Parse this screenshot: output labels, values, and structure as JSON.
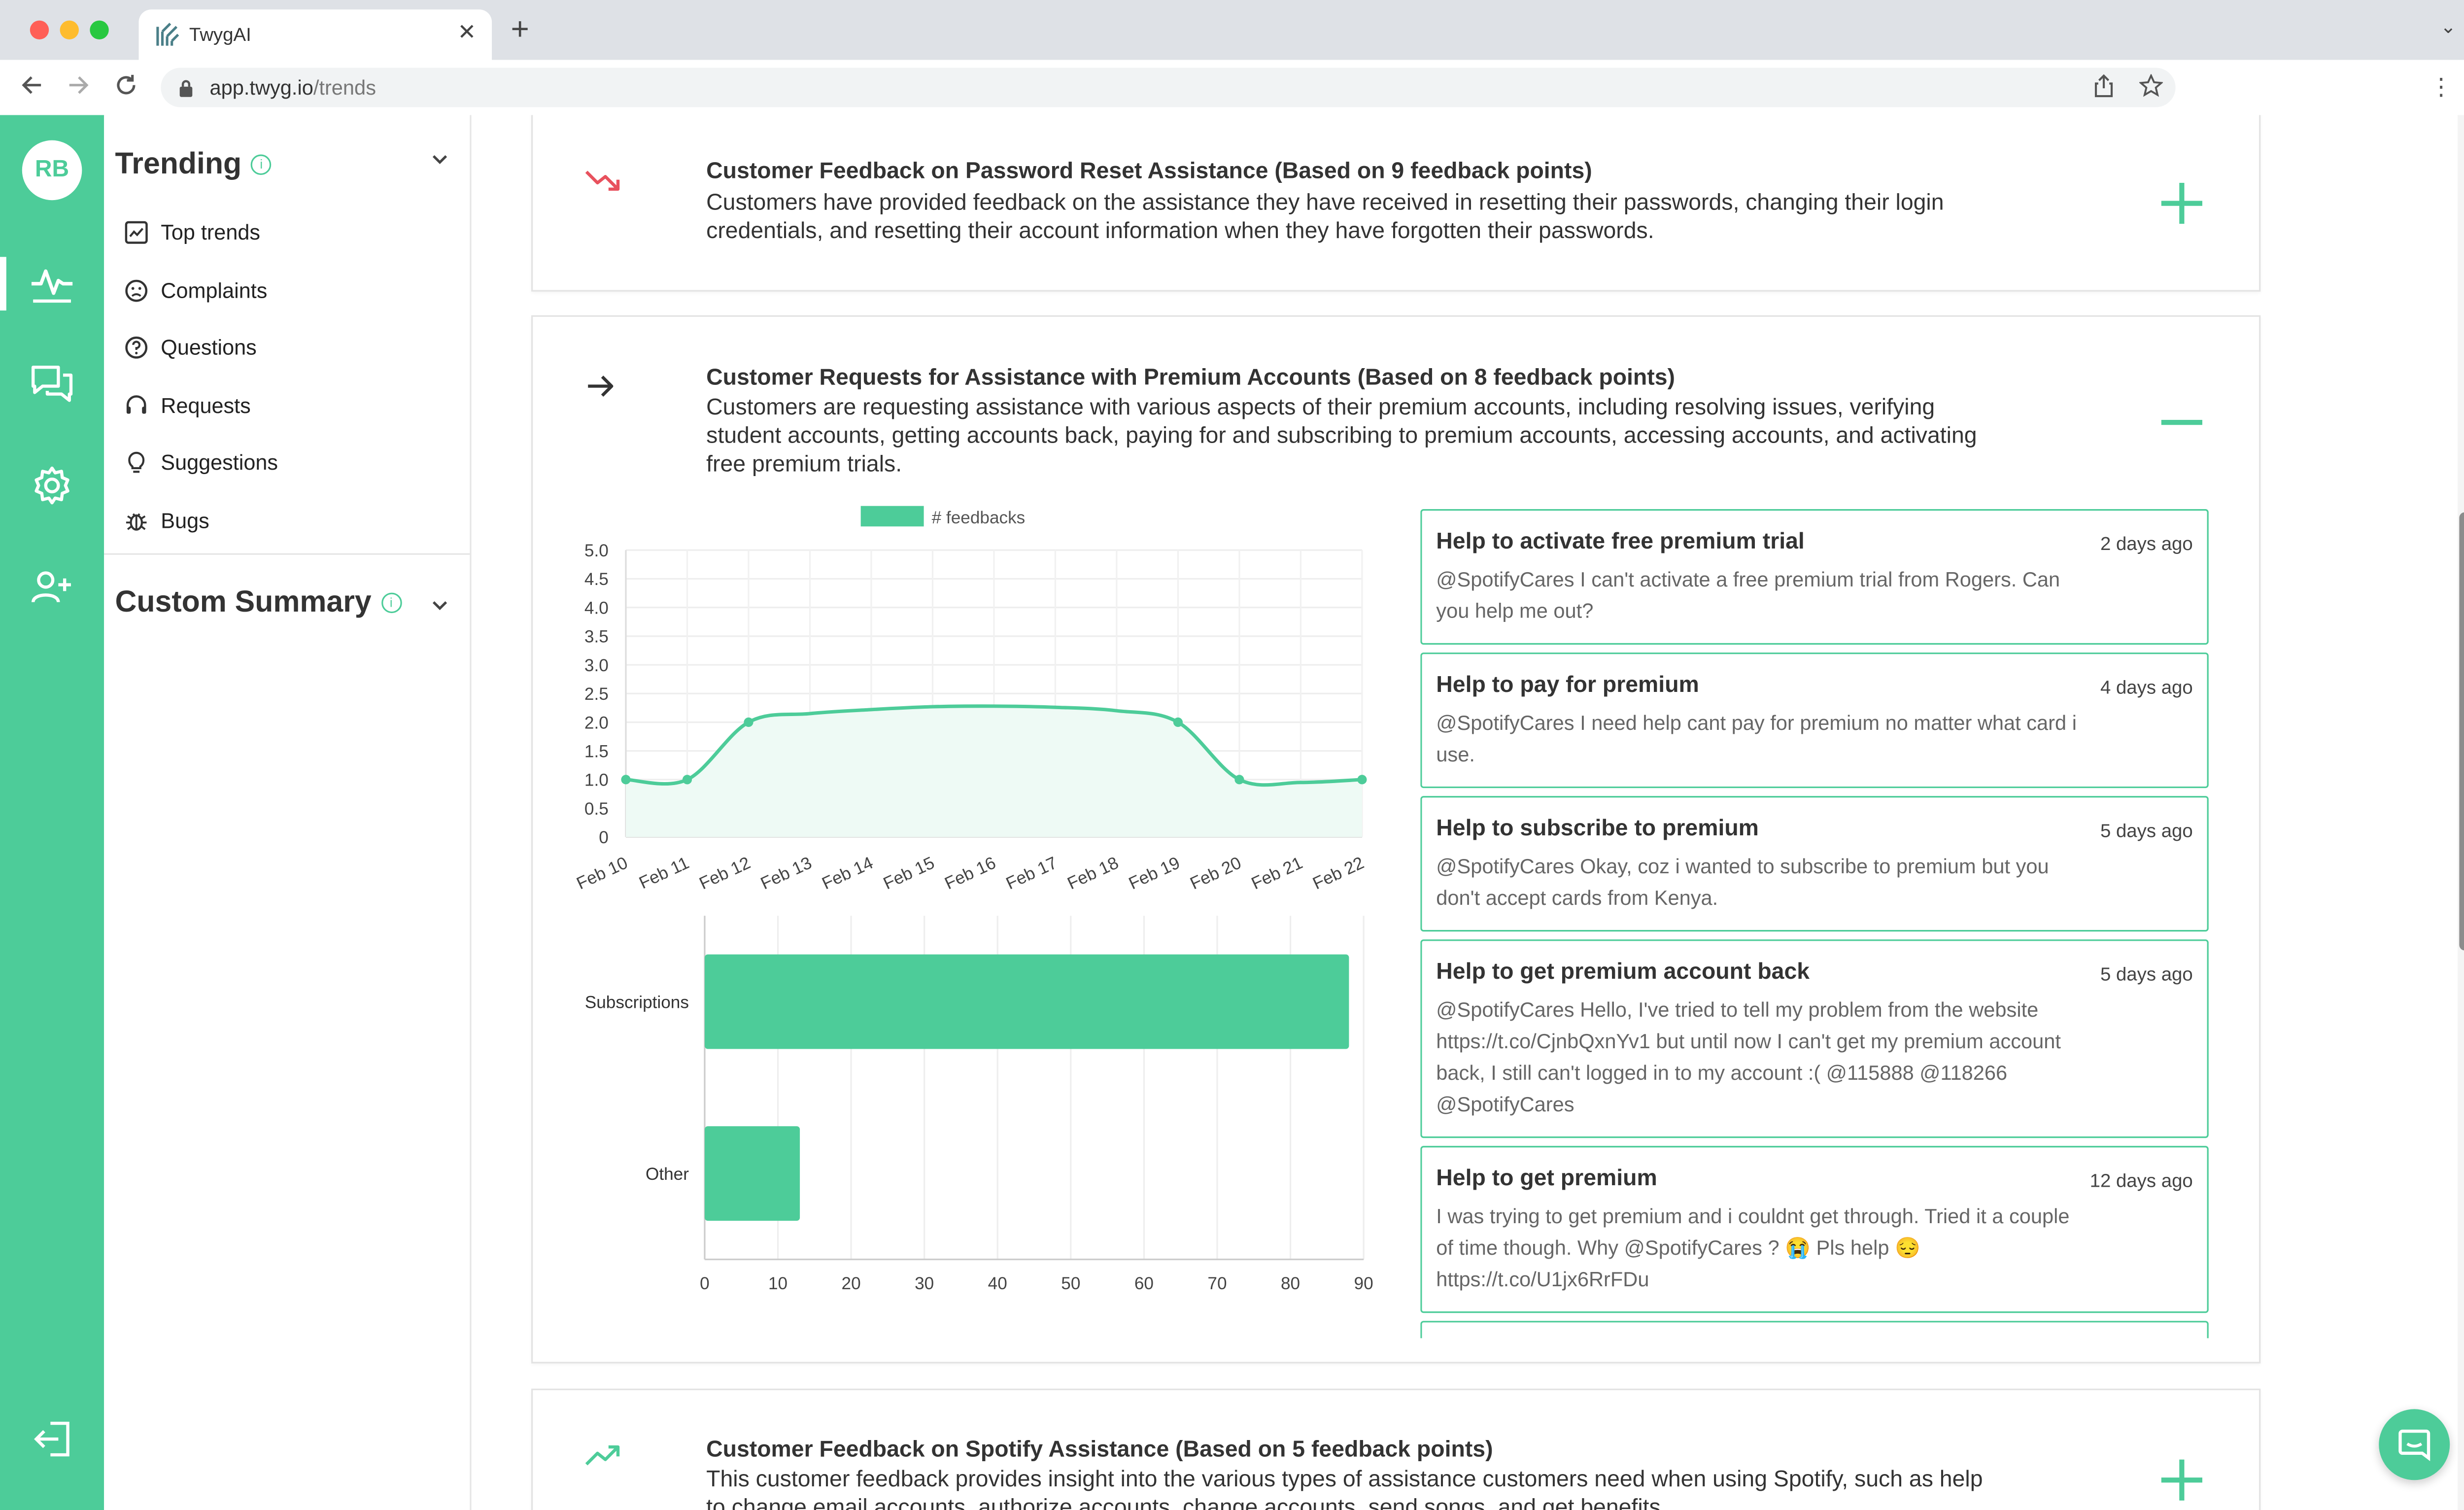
{
  "browser": {
    "tab_title": "TwygAI",
    "url_host": "app.twyg.io",
    "url_path": "/trends"
  },
  "user": {
    "initials": "RB"
  },
  "sidebar": {
    "trending_title": "Trending",
    "items": [
      {
        "label": "Top trends",
        "icon": "chart-icon"
      },
      {
        "label": "Complaints",
        "icon": "frown-icon"
      },
      {
        "label": "Questions",
        "icon": "question-icon"
      },
      {
        "label": "Requests",
        "icon": "headset-icon"
      },
      {
        "label": "Suggestions",
        "icon": "lightbulb-icon"
      },
      {
        "label": "Bugs",
        "icon": "bug-icon"
      }
    ],
    "custom_summary_title": "Custom Summary"
  },
  "trends": [
    {
      "direction": "down",
      "title": "Customer Feedback on Password Reset Assistance (Based on 9 feedback points)",
      "description": "Customers have provided feedback on the assistance they have received in resetting their passwords, changing their login credentials, and resetting their account information when they have forgotten their passwords.",
      "expanded": false
    },
    {
      "direction": "flat",
      "title": "Customer Requests for Assistance with Premium Accounts (Based on 8 feedback points)",
      "description": "Customers are requesting assistance with various aspects of their premium accounts, including resolving issues, verifying student accounts, getting accounts back, paying for and subscribing to premium accounts, accessing accounts, and activating free premium trials.",
      "expanded": true
    },
    {
      "direction": "up",
      "title": "Customer Feedback on Spotify Assistance (Based on 5 feedback points)",
      "description": "This customer feedback provides insight into the various types of assistance customers need when using Spotify, such as help to change email accounts, authorize accounts, change accounts, send songs, and get benefits",
      "expanded": false
    }
  ],
  "feedbacks": [
    {
      "title": "Help to activate free premium trial",
      "time": "2 days ago",
      "text": "@SpotifyCares I can't activate a free premium trial from Rogers. Can you help me out?"
    },
    {
      "title": "Help to pay for premium",
      "time": "4 days ago",
      "text": "@SpotifyCares I need help cant pay for premium no matter what card i use."
    },
    {
      "title": "Help to subscribe to premium",
      "time": "5 days ago",
      "text": "@SpotifyCares Okay, coz i wanted to subscribe to premium but you don't accept cards from Kenya."
    },
    {
      "title": "Help to get premium account back",
      "time": "5 days ago",
      "text": "@SpotifyCares Hello, I've tried to tell my problem from the website https://t.co/CjnbQxnYv1 but until now I can't get my premium account back, I still can't logged in to my account :( @115888 @118266 @SpotifyCares"
    },
    {
      "title": "Help to get premium",
      "time": "12 days ago",
      "text": "I was trying to get premium and i couldnt get through. Tried it a couple of time though. Why @SpotifyCares ? 😭 Pls help 😔 https://t.co/U1jx6RrFDu"
    }
  ],
  "colors": {
    "accent": "#4dcc99",
    "down": "#e8515d",
    "area_fill": "#eefaf5"
  },
  "chart_data": [
    {
      "type": "line",
      "x": [
        "Feb 10",
        "Feb 11",
        "Feb 12",
        "Feb 13",
        "Feb 14",
        "Feb 15",
        "Feb 16",
        "Feb 17",
        "Feb 18",
        "Feb 19",
        "Feb 20",
        "Feb 21",
        "Feb 22"
      ],
      "series": [
        {
          "name": "# feedbacks",
          "values": [
            1,
            1,
            2,
            2.15,
            2.22,
            2.27,
            2.28,
            2.26,
            2.2,
            2,
            1,
            0.95,
            1
          ],
          "markers": [
            0,
            1,
            2,
            9,
            10,
            12
          ]
        }
      ],
      "ylim": [
        0,
        5
      ],
      "yticks": [
        "5.0",
        "4.5",
        "4.0",
        "3.5",
        "3.0",
        "2.5",
        "2.0",
        "1.5",
        "1.0",
        "0.5",
        "0"
      ],
      "legend": "top",
      "area": true,
      "grid": true
    },
    {
      "type": "bar",
      "orientation": "horizontal",
      "categories": [
        "Subscriptions",
        "Other"
      ],
      "values": [
        88,
        13
      ],
      "xlim": [
        0,
        90
      ],
      "xticks": [
        "0",
        "10",
        "20",
        "30",
        "40",
        "50",
        "60",
        "70",
        "80",
        "90"
      ],
      "grid": true
    }
  ]
}
